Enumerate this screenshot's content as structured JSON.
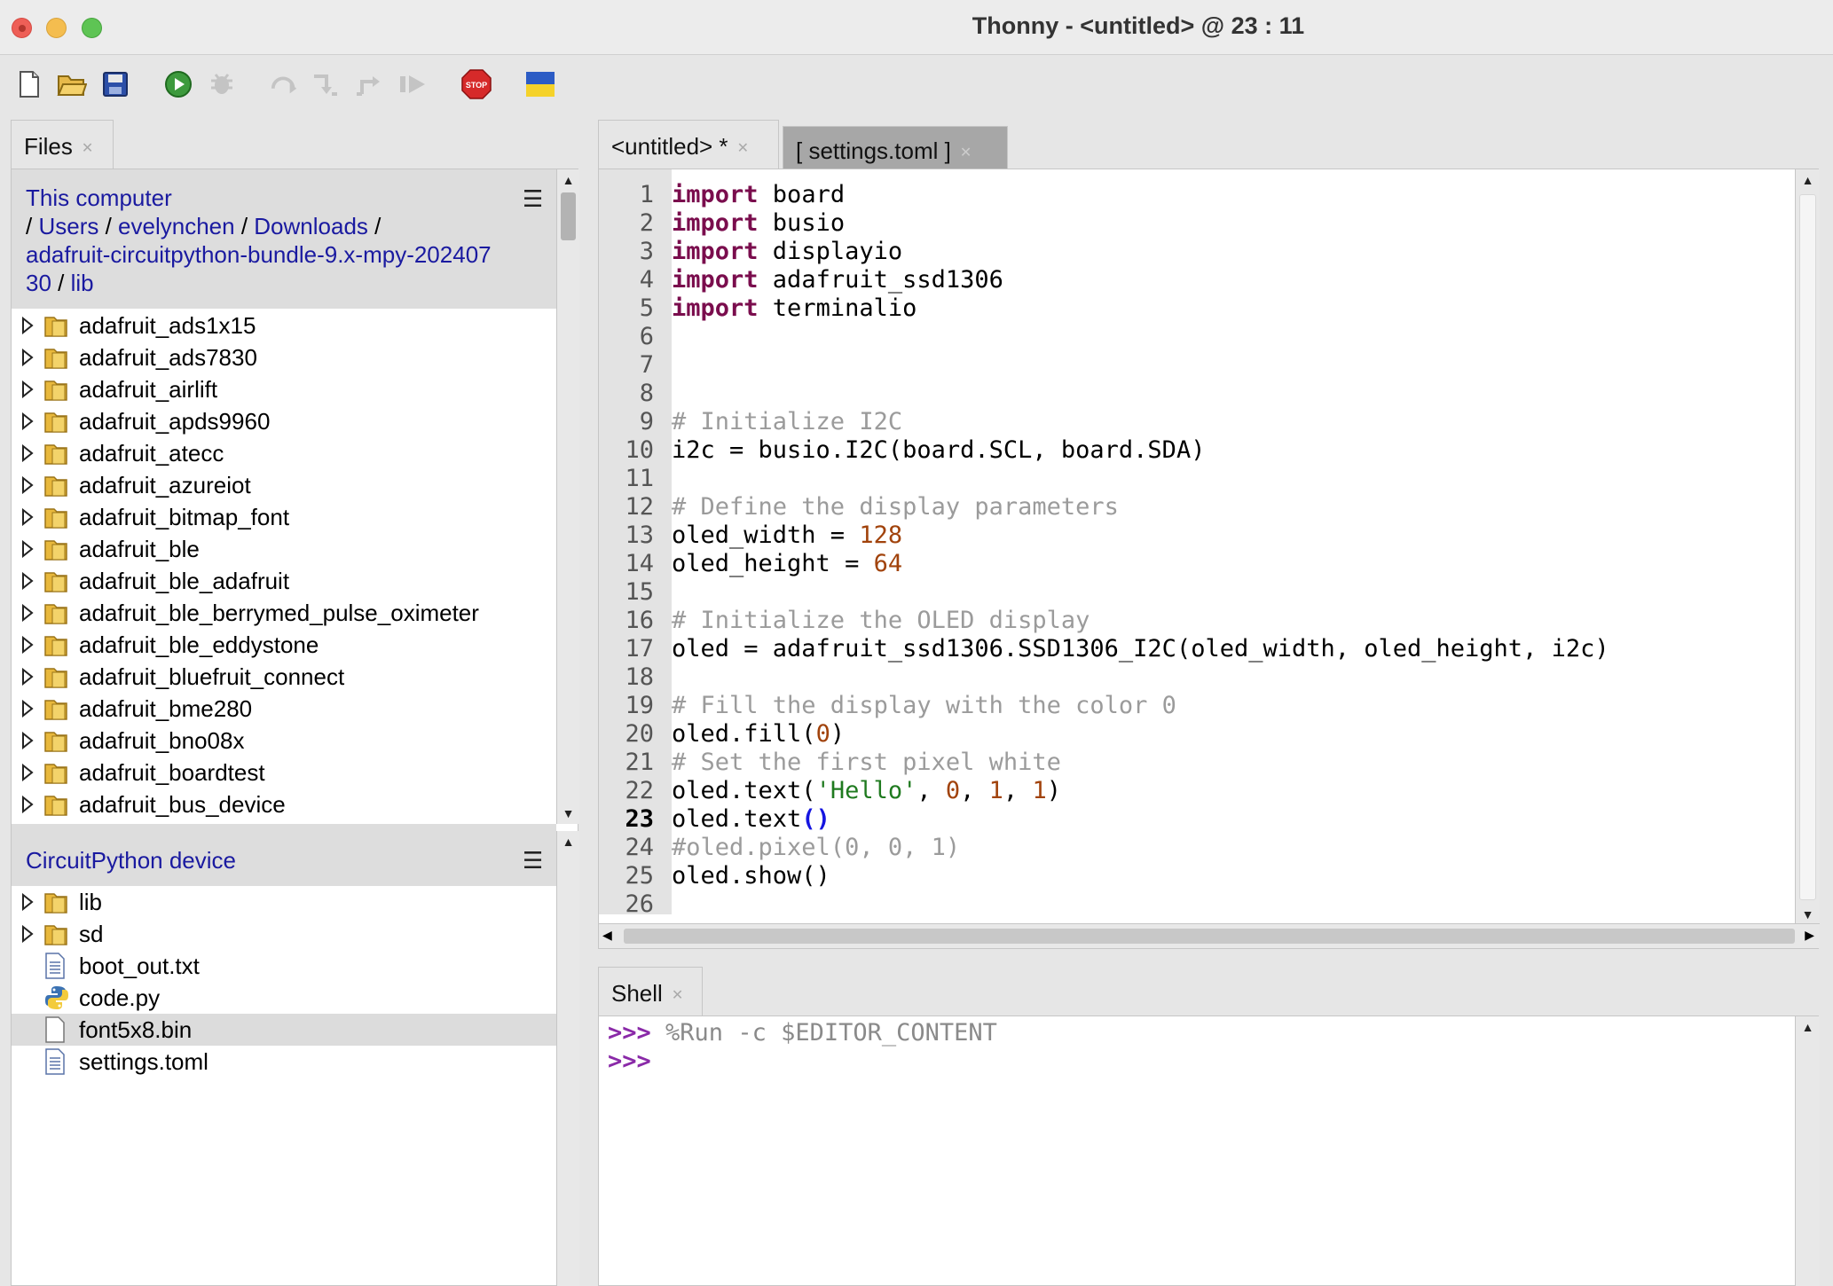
{
  "window": {
    "title": "Thonny  -  <untitled>  @  23 : 11"
  },
  "toolbar": {
    "buttons": [
      "new-file-icon",
      "open-folder-icon",
      "save-icon",
      "run-icon",
      "debug-icon",
      "step-over-icon",
      "step-into-icon",
      "step-out-icon",
      "resume-icon",
      "stop-icon",
      "ukraine-flag-icon"
    ]
  },
  "files": {
    "tab_label": "Files",
    "path": {
      "root": "This computer",
      "segments": [
        "Users",
        "evelynchen",
        "Downloads",
        "adafruit-circuitpython-bundle-9.x-mpy-202407",
        "30",
        "lib"
      ]
    },
    "local_items": [
      "adafruit_ads1x15",
      "adafruit_ads7830",
      "adafruit_airlift",
      "adafruit_apds9960",
      "adafruit_atecc",
      "adafruit_azureiot",
      "adafruit_bitmap_font",
      "adafruit_ble",
      "adafruit_ble_adafruit",
      "adafruit_ble_berrymed_pulse_oximeter",
      "adafruit_ble_eddystone",
      "adafruit_bluefruit_connect",
      "adafruit_bme280",
      "adafruit_bno08x",
      "adafruit_boardtest",
      "adafruit_bus_device"
    ],
    "device_header": "CircuitPython device",
    "device_items": [
      {
        "name": "lib",
        "type": "folder"
      },
      {
        "name": "sd",
        "type": "folder"
      },
      {
        "name": "boot_out.txt",
        "type": "text"
      },
      {
        "name": "code.py",
        "type": "python"
      },
      {
        "name": "font5x8.bin",
        "type": "blank",
        "selected": true
      },
      {
        "name": "settings.toml",
        "type": "text"
      }
    ]
  },
  "editor": {
    "tabs": [
      {
        "label": "<untitled> *",
        "active": true
      },
      {
        "label": "[ settings.toml ]",
        "active": false
      }
    ],
    "current_line": 23,
    "lines": [
      "import board",
      "import busio",
      "import displayio",
      "import adafruit_ssd1306",
      "import terminalio",
      "",
      "",
      "",
      "# Initialize I2C",
      "i2c = busio.I2C(board.SCL, board.SDA)",
      "",
      "# Define the display parameters",
      "oled_width = 128",
      "oled_height = 64",
      "",
      "# Initialize the OLED display",
      "oled = adafruit_ssd1306.SSD1306_I2C(oled_width, oled_height, i2c)",
      "",
      "# Fill the display with the color 0",
      "oled.fill(0)",
      "# Set the first pixel white",
      "oled.text('Hello', 0, 1, 1)",
      "oled.text()",
      "#oled.pixel(0, 0, 1)",
      "oled.show()",
      ""
    ]
  },
  "shell": {
    "tab_label": "Shell",
    "lines": [
      {
        "prompt": ">>>",
        "text": " %Run -c $EDITOR_CONTENT"
      },
      {
        "prompt": ">>>",
        "text": ""
      }
    ]
  }
}
